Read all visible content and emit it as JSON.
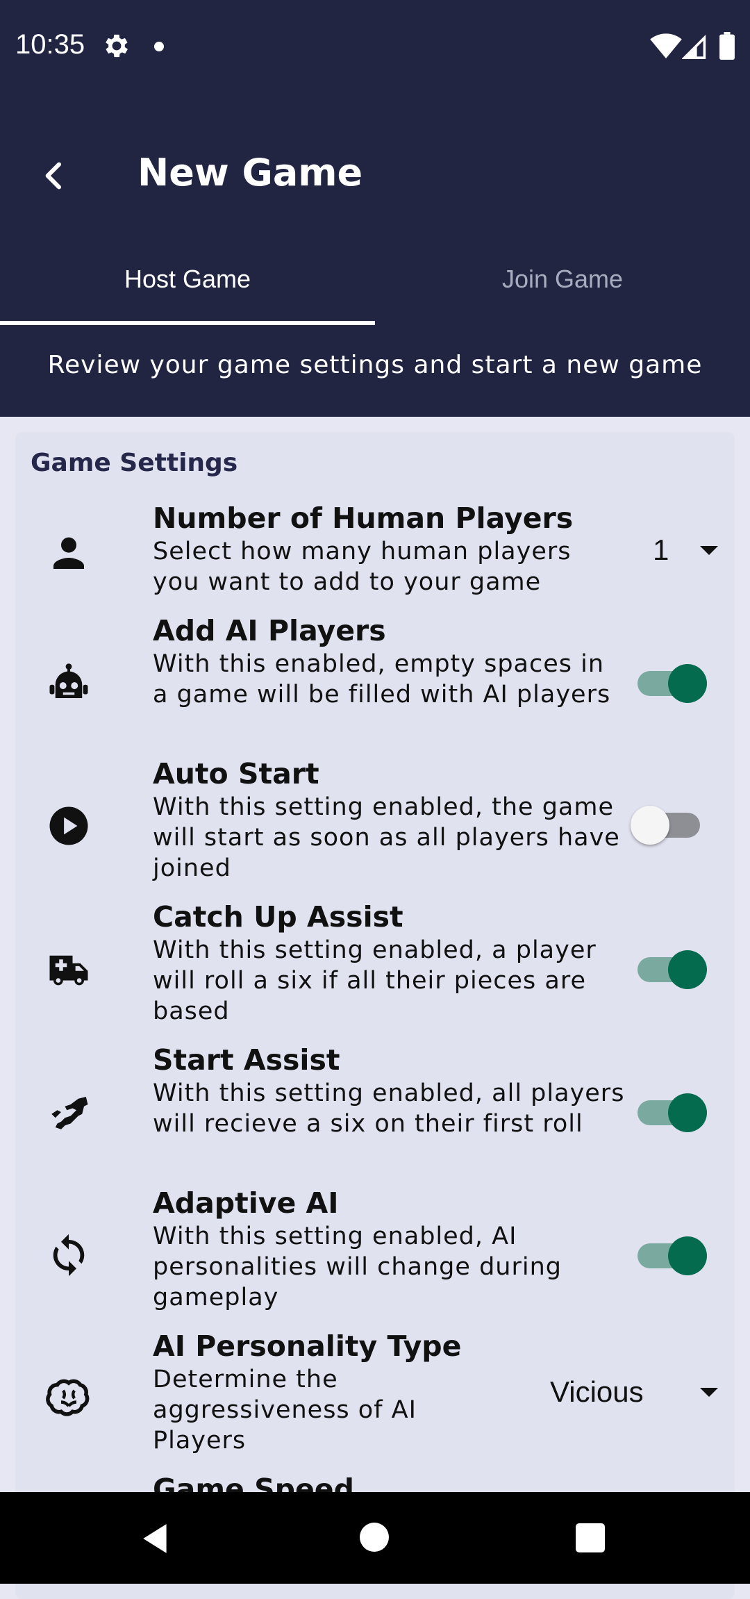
{
  "status_bar": {
    "time": "10:35",
    "icons": [
      "gear-icon",
      "notification-dot-icon",
      "wifi-icon",
      "signal-icon",
      "battery-icon"
    ]
  },
  "app_bar": {
    "title": "New Game",
    "back_icon": "chevron-left-icon",
    "tabs": [
      {
        "label": "Host Game",
        "selected": true
      },
      {
        "label": "Join Game",
        "selected": false
      }
    ],
    "subtitle": "Review your game settings and start a new game"
  },
  "card": {
    "title": "Game Settings",
    "settings": [
      {
        "icon": "person-icon",
        "title": "Number of Human Players",
        "description": "Select how many human players you want to add to your game",
        "control": "dropdown",
        "value": "1"
      },
      {
        "icon": "robot-icon",
        "title": "Add AI Players",
        "description": "With this enabled, empty spaces in a game will be filled with AI players",
        "control": "toggle",
        "enabled": true
      },
      {
        "icon": "play-circle-icon",
        "title": "Auto Start",
        "description": "With this setting enabled, the game will start as soon as all players have joined",
        "control": "toggle",
        "enabled": false
      },
      {
        "icon": "ambulance-icon",
        "title": "Catch Up Assist",
        "description": "With this setting enabled, a player will roll a six if all their pieces are based",
        "control": "toggle",
        "enabled": true
      },
      {
        "icon": "handshake-icon",
        "title": "Start Assist",
        "description": "With this setting enabled, all players will recieve a six on their first roll",
        "control": "toggle",
        "enabled": true
      },
      {
        "icon": "sync-icon",
        "title": "Adaptive AI",
        "description": "With this setting enabled, AI personalities will change during gameplay",
        "control": "toggle",
        "enabled": true
      },
      {
        "icon": "brain-icon",
        "title": "AI Personality Type",
        "description": "Determine the aggressiveness of AI Players",
        "control": "dropdown",
        "value": "Vicious"
      },
      {
        "icon": "",
        "title": "Game Speed",
        "description": "",
        "control": "",
        "value": ""
      }
    ]
  },
  "nav_bar": {
    "icons": [
      "nav-back-icon",
      "nav-home-icon",
      "nav-recents-icon"
    ]
  },
  "colors": {
    "header_bg": "#212542",
    "card_bg": "#e1e2ef",
    "page_bg": "#e6e7f3",
    "toggle_on": "#056b4f",
    "toggle_on_track": "#7aa9a0"
  }
}
